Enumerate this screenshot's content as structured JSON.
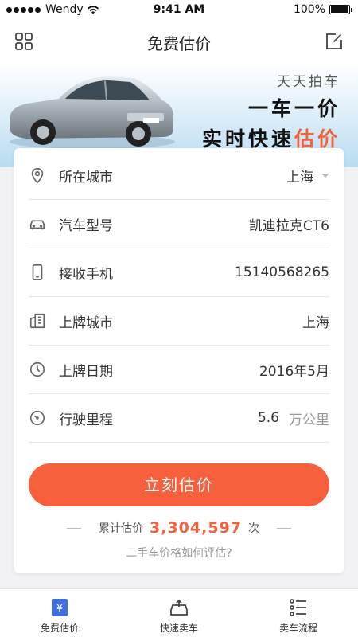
{
  "status_bar": {
    "carrier": "Wendy",
    "time": "9:41 AM",
    "battery": "100%"
  },
  "header": {
    "title": "免费估价"
  },
  "banner": {
    "line1": "天天拍车",
    "line2": "一车一价",
    "line3_main": "实时快速",
    "line3_accent": "估价",
    "accent_color": "#f4623c"
  },
  "form": {
    "rows": [
      {
        "label": "所在城市",
        "value": "上海",
        "icon": "location-pin-icon"
      },
      {
        "label": "汽车型号",
        "value": "凯迪拉克CT6",
        "icon": "car-icon"
      },
      {
        "label": "接收手机",
        "value": "15140568265",
        "icon": "phone-icon"
      },
      {
        "label": "上牌城市",
        "value": "上海",
        "icon": "building-icon"
      },
      {
        "label": "上牌日期",
        "value": "2016年5月",
        "icon": "clock-icon"
      },
      {
        "label": "行驶里程",
        "value": "5.6",
        "unit": "万公里",
        "icon": "speedometer-icon"
      }
    ]
  },
  "cta": {
    "label": "立刻估价",
    "color": "#f7603c"
  },
  "stats": {
    "prefix": "累计估价",
    "count": "3,304,597",
    "suffix": "次"
  },
  "help_link": "二手车价格如何评估?",
  "tabs": [
    {
      "label": "免费估价",
      "icon": "price-tag-icon",
      "active": true
    },
    {
      "label": "快速卖车",
      "icon": "car-upload-icon",
      "active": false
    },
    {
      "label": "卖车流程",
      "icon": "list-icon",
      "active": false
    }
  ]
}
